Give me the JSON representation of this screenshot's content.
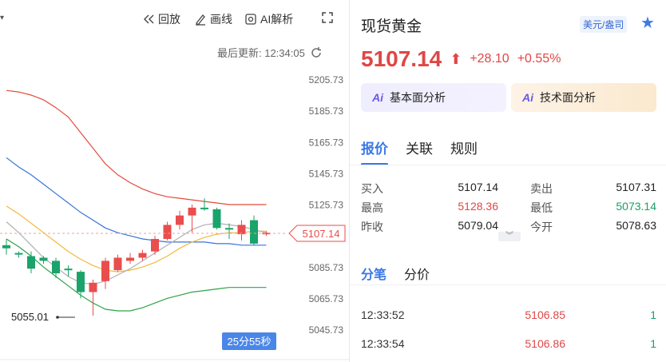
{
  "toolbar": {
    "replay_label": "回放",
    "draw_label": "画线",
    "ai_label": "AI解析"
  },
  "chart_header": {
    "last_updated": "最后更新: 12:34:05"
  },
  "chart_data": {
    "type": "candlestick",
    "y_ticks": [
      "5205.73",
      "5185.73",
      "5165.73",
      "5145.73",
      "5125.73",
      "5105.73",
      "5085.73",
      "5065.73",
      "5045.73"
    ],
    "ylim": [
      5045.73,
      5205.73
    ],
    "current_price_label": "5107.14",
    "low_marker_label": "5055.01",
    "countdown": "25分55秒",
    "candles": [
      {
        "o": 5100,
        "c": 5098,
        "h": 5104,
        "l": 5094,
        "up": false
      },
      {
        "o": 5095,
        "c": 5094,
        "h": 5096,
        "l": 5092,
        "up": false
      },
      {
        "o": 5093,
        "c": 5085,
        "h": 5096,
        "l": 5082,
        "up": false
      },
      {
        "o": 5092,
        "c": 5090,
        "h": 5093,
        "l": 5088,
        "up": false
      },
      {
        "o": 5090,
        "c": 5082,
        "h": 5092,
        "l": 5079,
        "up": false
      },
      {
        "o": 5085,
        "c": 5084,
        "h": 5087,
        "l": 5080,
        "up": false
      },
      {
        "o": 5083,
        "c": 5070,
        "h": 5084,
        "l": 5066,
        "up": false
      },
      {
        "o": 5070,
        "c": 5076,
        "h": 5078,
        "l": 5055,
        "up": true
      },
      {
        "o": 5077,
        "c": 5090,
        "h": 5092,
        "l": 5072,
        "up": true
      },
      {
        "o": 5084,
        "c": 5092,
        "h": 5094,
        "l": 5083,
        "up": true
      },
      {
        "o": 5090,
        "c": 5092,
        "h": 5095,
        "l": 5088,
        "up": true
      },
      {
        "o": 5092,
        "c": 5095,
        "h": 5097,
        "l": 5090,
        "up": true
      },
      {
        "o": 5096,
        "c": 5104,
        "h": 5106,
        "l": 5094,
        "up": true
      },
      {
        "o": 5104,
        "c": 5113,
        "h": 5115,
        "l": 5103,
        "up": true
      },
      {
        "o": 5113,
        "c": 5119,
        "h": 5122,
        "l": 5110,
        "up": true
      },
      {
        "o": 5119,
        "c": 5124,
        "h": 5126,
        "l": 5108,
        "up": true
      },
      {
        "o": 5124,
        "c": 5124,
        "h": 5130,
        "l": 5122,
        "up": false
      },
      {
        "o": 5123,
        "c": 5111,
        "h": 5124,
        "l": 5110,
        "up": false
      },
      {
        "o": 5111,
        "c": 5110,
        "h": 5114,
        "l": 5104,
        "up": false
      },
      {
        "o": 5107,
        "c": 5113,
        "h": 5116,
        "l": 5103,
        "up": true
      },
      {
        "o": 5116,
        "c": 5101,
        "h": 5119,
        "l": 5100,
        "up": false
      },
      {
        "o": 5108,
        "c": 5107,
        "h": 5109,
        "l": 5106,
        "up": true
      }
    ],
    "colors": {
      "up": "#ea4d4d",
      "down": "#1aa36b",
      "upper_band": "#e24b3b",
      "middle_band": "#3a74d8",
      "lower_band": "#2ea24a",
      "ma_yellow": "#f2b93b",
      "ma_gray": "#b0b0b0"
    }
  },
  "quote_panel": {
    "title": "现货黄金",
    "currency_badge": "美元/盎司",
    "price": "5107.14",
    "change": "+28.10",
    "change_pct": "+0.55%",
    "fundamental_btn": "基本面分析",
    "technical_btn": "技术面分析",
    "ai_mark": "Ai",
    "tabs": [
      "报价",
      "关联",
      "规则"
    ],
    "rows": [
      {
        "l1": "买入",
        "v1": "5107.14",
        "l2": "卖出",
        "v2": "5107.31"
      },
      {
        "l1": "最高",
        "v1": "5128.36",
        "l2": "最低",
        "v2": "5073.14"
      },
      {
        "l1": "昨收",
        "v1": "5079.04",
        "l2": "今开",
        "v2": "5078.63"
      }
    ],
    "sub_tabs": [
      "分笔",
      "分价"
    ],
    "trades": [
      {
        "time": "12:33:52",
        "price": "5106.85",
        "vol": "1"
      },
      {
        "time": "12:33:54",
        "price": "5106.86",
        "vol": "1"
      }
    ]
  }
}
